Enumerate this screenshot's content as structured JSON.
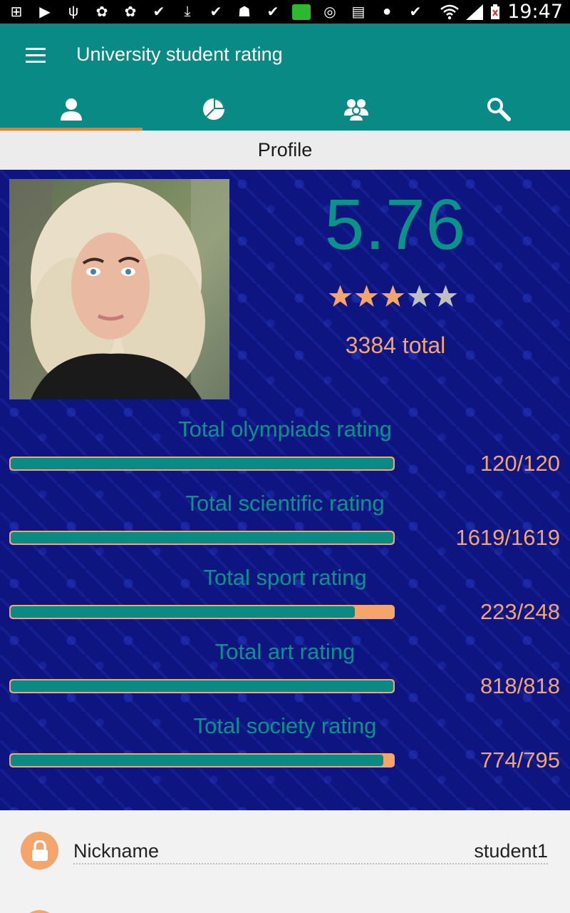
{
  "status_bar": {
    "time": "19:47",
    "icons": [
      "add-box-icon",
      "youtube-icon",
      "usb-icon",
      "paw-icon",
      "paw-icon",
      "check-icon",
      "download-icon",
      "check-icon",
      "android-icon",
      "check-icon",
      "screen-icon",
      "wireless-icon",
      "file-icon",
      "badge-icon",
      "check-icon",
      "wifi-icon",
      "signal-icon",
      "battery-icon"
    ]
  },
  "app_bar": {
    "title": "University student rating",
    "tabs": [
      {
        "icon": "person-icon",
        "active": true
      },
      {
        "icon": "pie-chart-icon",
        "active": false
      },
      {
        "icon": "group-icon",
        "active": false
      },
      {
        "icon": "search-icon",
        "active": false
      }
    ]
  },
  "section": {
    "title": "Profile"
  },
  "profile": {
    "score": "5.76",
    "stars_filled": 3,
    "stars_total": 5,
    "total_text": "3384 total",
    "ratings": [
      {
        "label": "Total olympiads rating",
        "value": "120/120",
        "fraction": 1.0
      },
      {
        "label": "Total scientific rating",
        "value": "1619/1619",
        "fraction": 1.0
      },
      {
        "label": "Total sport rating",
        "value": "223/248",
        "fraction": 0.899
      },
      {
        "label": "Total art rating",
        "value": "818/818",
        "fraction": 1.0
      },
      {
        "label": "Total society rating",
        "value": "774/795",
        "fraction": 0.974
      }
    ]
  },
  "details": {
    "items": [
      {
        "label": "Nickname",
        "value": "student1"
      }
    ]
  },
  "colors": {
    "teal": "#0a8a84",
    "accent_orange": "#f07b22",
    "peach": "#f4a56b",
    "navy": "#0e1480",
    "star_filled": "#f4a56b",
    "star_empty": "#c0c0c0"
  }
}
